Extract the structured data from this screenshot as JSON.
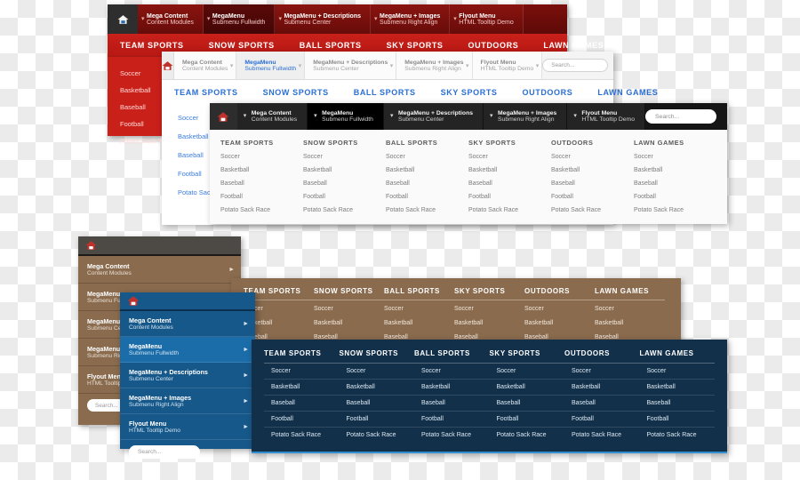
{
  "icons": {
    "home": "home-icon",
    "caret_down": "▾",
    "caret_right": "►"
  },
  "menu_tabs": [
    {
      "t1": "Mega Content",
      "t2": "Content Modules"
    },
    {
      "t1": "MegaMenu",
      "t2": "Submenu Fullwidth"
    },
    {
      "t1": "MegaMenu + Descriptions",
      "t2": "Submenu Center"
    },
    {
      "t1": "MegaMenu + Images",
      "t2": "Submenu Right Align"
    },
    {
      "t1": "Flyout Menu",
      "t2": "HTML Tooltip Demo"
    }
  ],
  "nav_items": [
    "TEAM SPORTS",
    "SNOW SPORTS",
    "BALL SPORTS",
    "SKY SPORTS",
    "OUTDOORS",
    "LAWN GAMES"
  ],
  "sub_items": [
    "Soccer",
    "Basketball",
    "Baseball",
    "Football",
    "Potato Sack Race"
  ],
  "search": {
    "placeholder": "Search...",
    "value": "Search..."
  },
  "panels": {
    "red": {
      "name": "Red Theme MegaMenu",
      "accent": "#c9201a",
      "active_tab_index": 1
    },
    "white": {
      "name": "Light Theme MegaMenu",
      "accent": "#2a6fd4",
      "active_tab_index": 1
    },
    "dark": {
      "name": "Dark Theme MegaMenu",
      "accent": "#151515",
      "active_tab_index": 1
    },
    "grey": {
      "name": "Grey Vertical Menu",
      "accent": "#8a6b4e",
      "active_tab_index": 1
    },
    "brown": {
      "name": "Brown MegaMenu Panel",
      "accent": "#8a6b4e"
    },
    "blue": {
      "name": "Blue Vertical Menu",
      "accent": "#17588a",
      "active_tab_index": 1
    },
    "navy": {
      "name": "Navy MegaMenu Panel",
      "accent": "#12304a"
    }
  }
}
